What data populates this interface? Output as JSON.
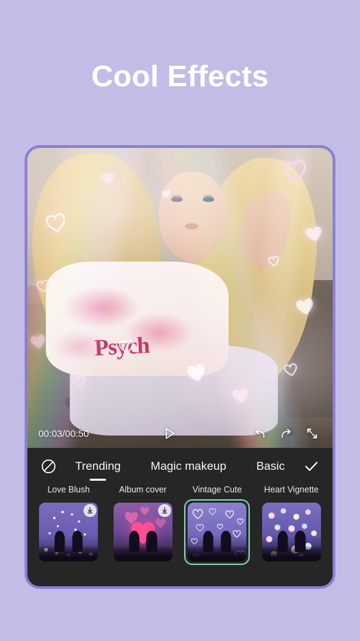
{
  "page": {
    "title": "Cool Effects",
    "background_color": "#c3bce6",
    "title_color": "#ffffff",
    "frame_border_color": "#8a7fd4",
    "panel_color": "#262626",
    "selection_color": "#7fd4b8"
  },
  "preview": {
    "shirt_text": "Psych",
    "timecode": "00:03/00:50",
    "controls": [
      {
        "name": "play-icon",
        "label": "Play"
      },
      {
        "name": "undo-icon",
        "label": "Undo"
      },
      {
        "name": "redo-icon",
        "label": "Redo"
      },
      {
        "name": "fullscreen-icon",
        "label": "Fullscreen"
      }
    ]
  },
  "effects_panel": {
    "no_effect_icon": "no-effect-icon",
    "confirm_icon": "check-icon",
    "tabs": [
      {
        "label": "Trending",
        "active": true
      },
      {
        "label": "Magic makeup",
        "active": false
      },
      {
        "label": "Basic",
        "active": false
      }
    ],
    "effects": [
      {
        "label": "Love Blush",
        "selected": false,
        "downloadable": true
      },
      {
        "label": "Album cover",
        "selected": false,
        "downloadable": true
      },
      {
        "label": "Vintage Cute",
        "selected": true,
        "downloadable": false
      },
      {
        "label": "Heart Vignette",
        "selected": false,
        "downloadable": false
      }
    ]
  }
}
